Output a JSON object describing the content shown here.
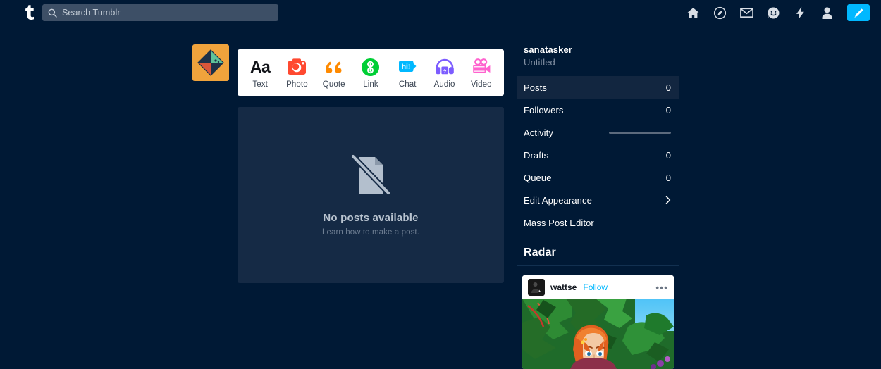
{
  "topbar": {
    "logo": "tumblr-logo",
    "search": {
      "placeholder": "Search Tumblr",
      "value": "",
      "icon": "search-icon"
    },
    "nav": [
      {
        "name": "home-icon",
        "label": "Home"
      },
      {
        "name": "explore-icon",
        "label": "Explore"
      },
      {
        "name": "inbox-icon",
        "label": "Inbox"
      },
      {
        "name": "messaging-icon",
        "label": "Messaging"
      },
      {
        "name": "activity-icon",
        "label": "Activity"
      },
      {
        "name": "account-icon",
        "label": "Account"
      }
    ],
    "compose": {
      "name": "compose-pencil-icon",
      "label": "Create post",
      "color": "#00b8ff"
    }
  },
  "composer": {
    "avatar_alt": "sanatasker avatar",
    "post_types": [
      {
        "key": "text",
        "label": "Text",
        "icon": "text-aa-icon",
        "color": "#111318"
      },
      {
        "key": "photo",
        "label": "Photo",
        "icon": "camera-icon",
        "color": "#ff4930"
      },
      {
        "key": "quote",
        "label": "Quote",
        "icon": "quote-icon",
        "color": "#ff8a00"
      },
      {
        "key": "link",
        "label": "Link",
        "icon": "link-chain-icon",
        "color": "#00cf35"
      },
      {
        "key": "chat",
        "label": "Chat",
        "icon": "chat-bubble-icon",
        "color": "#00b8ff"
      },
      {
        "key": "audio",
        "label": "Audio",
        "icon": "headphones-icon",
        "color": "#7c5cff"
      },
      {
        "key": "video",
        "label": "Video",
        "icon": "video-camera-icon",
        "color": "#ff62ce"
      }
    ]
  },
  "feed": {
    "empty": {
      "icon": "no-posts-document-slash-icon",
      "title": "No posts available",
      "subtitle": "Learn how to make a post."
    }
  },
  "sidebar": {
    "username": "sanatasker",
    "blog_title": "Untitled",
    "rows": [
      {
        "label": "Posts",
        "value": "0",
        "active": true,
        "type": "value"
      },
      {
        "label": "Followers",
        "value": "0",
        "active": false,
        "type": "value"
      },
      {
        "label": "Activity",
        "value": "",
        "active": false,
        "type": "bar"
      },
      {
        "label": "Drafts",
        "value": "0",
        "active": false,
        "type": "value"
      },
      {
        "label": "Queue",
        "value": "0",
        "active": false,
        "type": "value"
      },
      {
        "label": "Edit Appearance",
        "value": "",
        "active": false,
        "type": "chevron"
      },
      {
        "label": "Mass Post Editor",
        "value": "",
        "active": false,
        "type": "plain"
      }
    ],
    "radar": {
      "heading": "Radar",
      "post": {
        "blog_name": "wattse",
        "follow_label": "Follow",
        "menu_label": "•••",
        "image_alt": "Illustration of a red-haired person in a green jungle"
      }
    }
  },
  "colors": {
    "page_background": "#001935",
    "panel_background": "#152a45",
    "accent_blue": "#00b8ff",
    "search_background": "#3d4f66",
    "active_row": "#122640"
  }
}
